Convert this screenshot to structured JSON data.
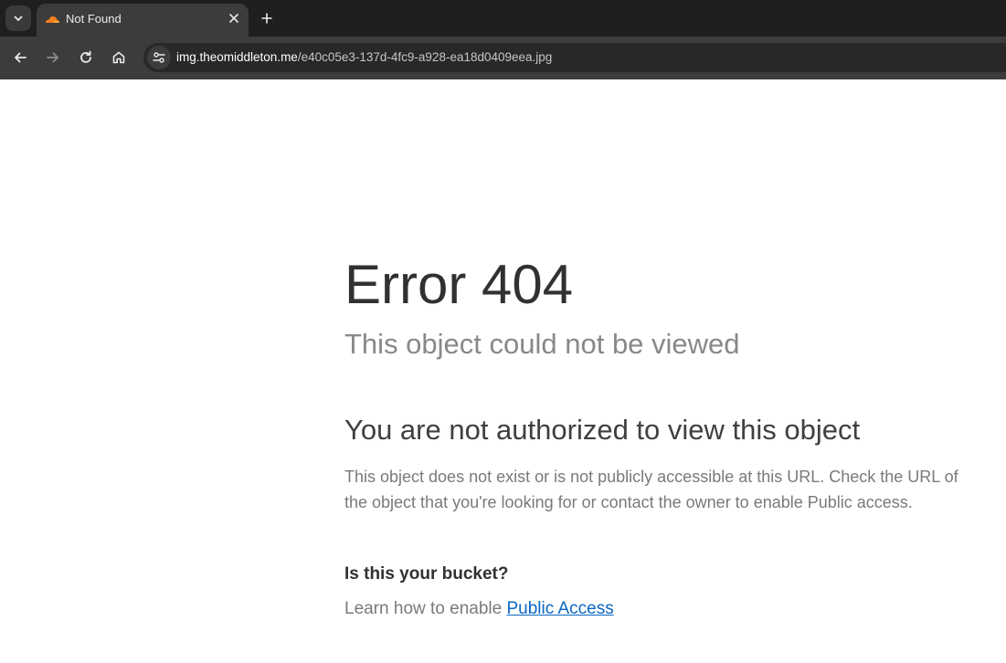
{
  "browser": {
    "tab": {
      "title": "Not Found",
      "favicon": "cloudflare-icon"
    },
    "address_bar": {
      "host": "img.theomiddleton.me",
      "path": "/e40c05e3-137d-4fc9-a928-ea18d0409eea.jpg"
    },
    "icons": {
      "tab_search": "chevron-down-icon",
      "close": "close-icon",
      "new_tab": "plus-icon",
      "back": "arrow-left-icon",
      "forward": "arrow-right-icon",
      "reload": "reload-icon",
      "home": "home-icon",
      "site_info": "tune-icon"
    },
    "colors": {
      "chrome_dark": "#1f1f1f",
      "chrome": "#3c3c3c",
      "favicon_orange": "#f48120"
    }
  },
  "page": {
    "error_title": "Error 404",
    "error_subtitle": "This object could not be viewed",
    "auth_heading": "You are not authorized to view this object",
    "auth_description": "This object does not exist or is not publicly accessible at this URL. Check the URL of the object that you're looking for or contact the owner to enable Public access.",
    "bucket_question": "Is this your bucket?",
    "learn_prefix": "Learn how to enable ",
    "learn_link": "Public Access",
    "colors": {
      "link": "#0b66c2",
      "title": "#313131",
      "muted": "#888888"
    }
  }
}
